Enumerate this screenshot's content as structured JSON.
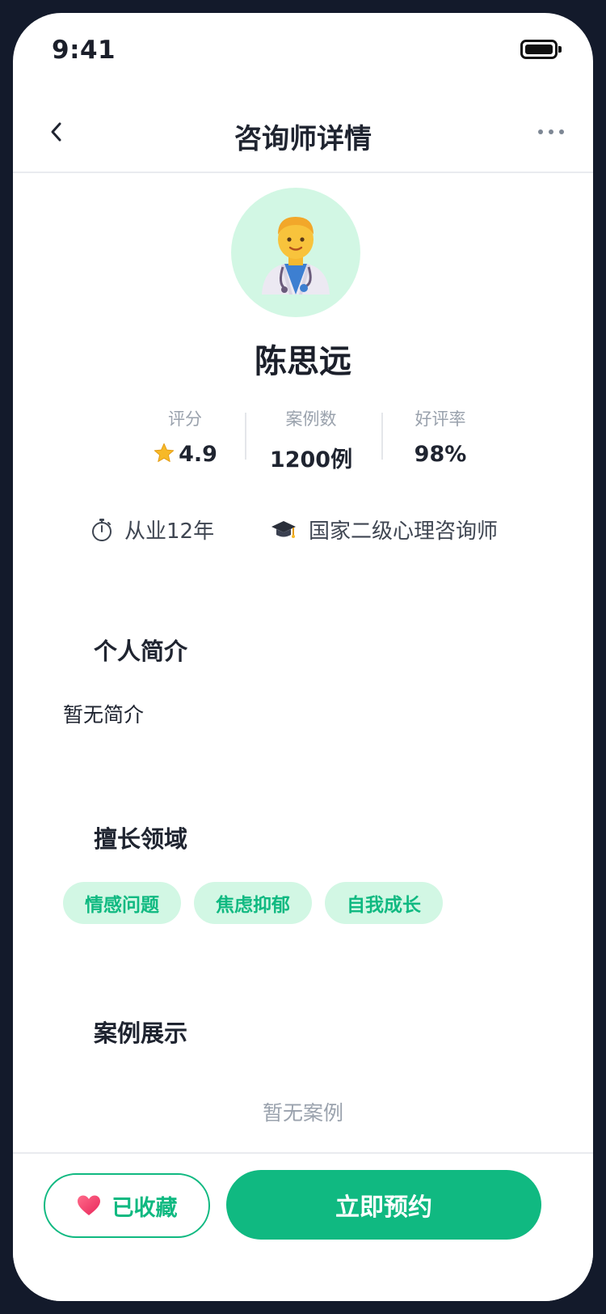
{
  "status_bar": {
    "time": "9:41"
  },
  "nav": {
    "title": "咨询师详情"
  },
  "profile": {
    "name": "陈思远",
    "stats": [
      {
        "label": "评分",
        "value": "4.9"
      },
      {
        "label": "案例数",
        "value": "1200例"
      },
      {
        "label": "好评率",
        "value": "98%"
      }
    ],
    "experience": "从业12年",
    "certification": "国家二级心理咨询师"
  },
  "intro": {
    "title": "个人简介",
    "text": "暂无简介"
  },
  "expertise": {
    "title": "擅长领域",
    "tags": [
      "情感问题",
      "焦虑抑郁",
      "自我成长"
    ]
  },
  "cases": {
    "title": "案例展示",
    "empty_text": "暂无案例"
  },
  "actions": {
    "favorite_label": "已收藏",
    "book_label": "立即预约"
  },
  "colors": {
    "accent": "#10b981",
    "accent_light": "#d2f7e4",
    "frame": "#131a2b"
  },
  "icons": {
    "avatar": "doctor-avatar-icon",
    "rating": "star-icon",
    "experience": "stopwatch-icon",
    "certification": "graduation-cap-icon",
    "favorite": "heart-icon"
  }
}
